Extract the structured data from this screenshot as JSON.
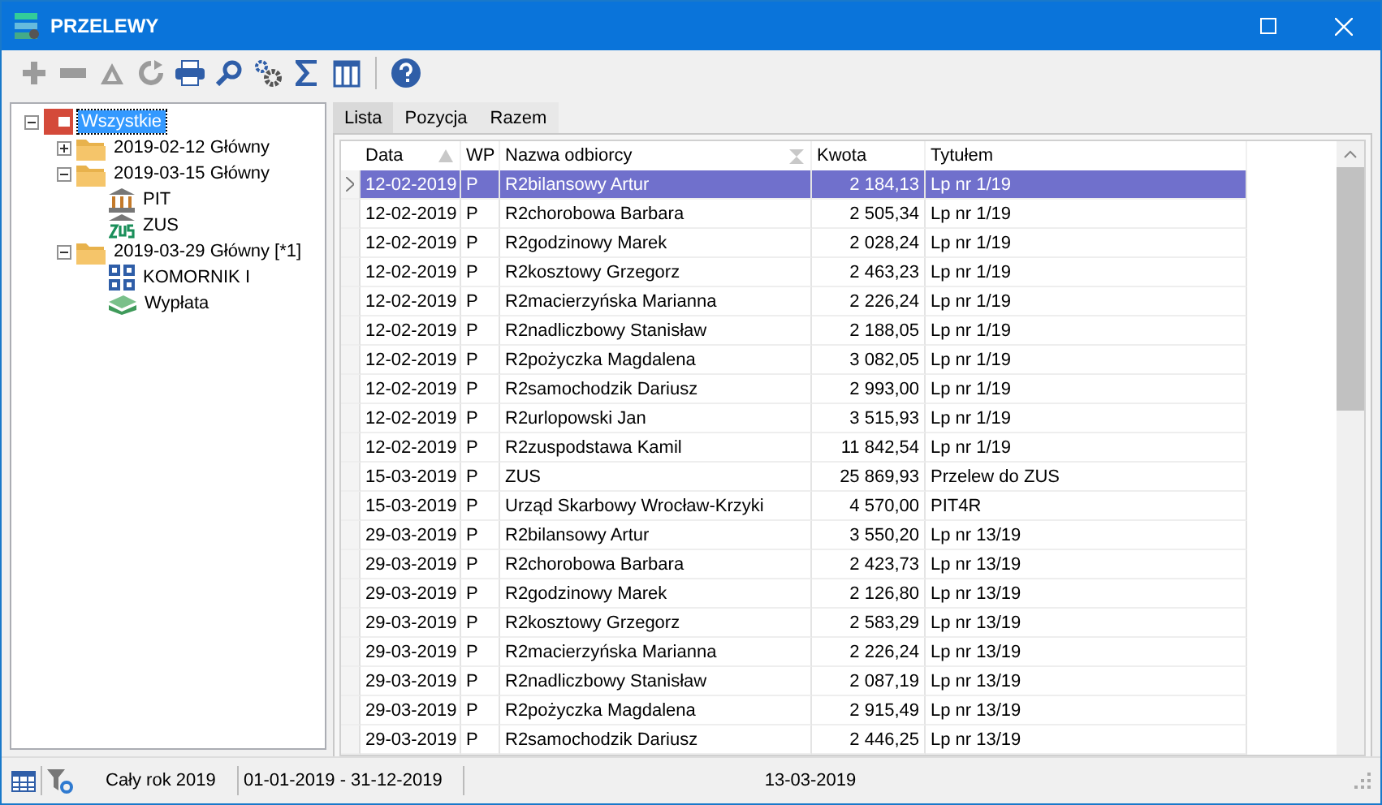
{
  "window": {
    "title": "PRZELEWY"
  },
  "toolbar": [
    {
      "kind": "add",
      "disabled": true
    },
    {
      "kind": "remove",
      "disabled": true
    },
    {
      "kind": "triangle",
      "disabled": true
    },
    {
      "kind": "refresh",
      "disabled": true
    },
    {
      "kind": "print",
      "disabled": false
    },
    {
      "kind": "search",
      "disabled": false
    },
    {
      "kind": "settings",
      "disabled": false
    },
    {
      "kind": "sum",
      "disabled": false
    },
    {
      "kind": "columns",
      "disabled": false
    },
    {
      "kind": "separator"
    },
    {
      "kind": "help",
      "disabled": false
    }
  ],
  "tree": [
    {
      "label": "Wszystkie",
      "kind": "root",
      "selected": true,
      "expanded": true,
      "children": [
        {
          "label": "2019-02-12 Główny",
          "kind": "folder",
          "selected": false,
          "expanded": false
        },
        {
          "label": "2019-03-15 Główny",
          "kind": "folder",
          "selected": false,
          "expanded": true,
          "children": [
            {
              "label": "PIT",
              "kind": "bank",
              "selected": false
            },
            {
              "label": "ZUS",
              "kind": "zus",
              "selected": false
            }
          ]
        },
        {
          "label": "2019-03-29 Główny [*1]",
          "kind": "folder",
          "selected": false,
          "expanded": true,
          "children": [
            {
              "label": "KOMORNIK I",
              "kind": "grid",
              "selected": false
            },
            {
              "label": "Wypłata",
              "kind": "money",
              "selected": false
            }
          ]
        }
      ]
    }
  ],
  "tabs": [
    {
      "label": "Lista",
      "selected": true
    },
    {
      "label": "Pozycja",
      "selected": false
    },
    {
      "label": "Razem",
      "selected": false
    }
  ],
  "table": {
    "columns": [
      {
        "label": "Data",
        "sorted": true,
        "summed": false
      },
      {
        "label": "WP",
        "sorted": false,
        "summed": false
      },
      {
        "label": "Nazwa odbiorcy",
        "sorted": false,
        "summed": true
      },
      {
        "label": "Kwota",
        "sorted": false,
        "summed": false
      },
      {
        "label": "Tytułem",
        "sorted": false,
        "summed": false
      }
    ],
    "rows": [
      {
        "cells": [
          "12-02-2019",
          "P",
          "R2bilansowy Artur",
          "2 184,13",
          "Lp nr 1/19"
        ],
        "selected": true
      },
      {
        "cells": [
          "12-02-2019",
          "P",
          "R2chorobowa Barbara",
          "2 505,34",
          "Lp nr 1/19"
        ],
        "selected": false
      },
      {
        "cells": [
          "12-02-2019",
          "P",
          "R2godzinowy Marek",
          "2 028,24",
          "Lp nr 1/19"
        ],
        "selected": false
      },
      {
        "cells": [
          "12-02-2019",
          "P",
          "R2kosztowy Grzegorz",
          "2 463,23",
          "Lp nr 1/19"
        ],
        "selected": false
      },
      {
        "cells": [
          "12-02-2019",
          "P",
          "R2macierzyńska Marianna",
          "2 226,24",
          "Lp nr 1/19"
        ],
        "selected": false
      },
      {
        "cells": [
          "12-02-2019",
          "P",
          "R2nadliczbowy Stanisław",
          "2 188,05",
          "Lp nr 1/19"
        ],
        "selected": false
      },
      {
        "cells": [
          "12-02-2019",
          "P",
          "R2pożyczka Magdalena",
          "3 082,05",
          "Lp nr 1/19"
        ],
        "selected": false
      },
      {
        "cells": [
          "12-02-2019",
          "P",
          "R2samochodzik Dariusz",
          "2 993,00",
          "Lp nr 1/19"
        ],
        "selected": false
      },
      {
        "cells": [
          "12-02-2019",
          "P",
          "R2urlopowski Jan",
          "3 515,93",
          "Lp nr 1/19"
        ],
        "selected": false
      },
      {
        "cells": [
          "12-02-2019",
          "P",
          "R2zuspodstawa Kamil",
          "11 842,54",
          "Lp nr 1/19"
        ],
        "selected": false
      },
      {
        "cells": [
          "15-03-2019",
          "P",
          "ZUS",
          "25 869,93",
          "Przelew do ZUS"
        ],
        "selected": false
      },
      {
        "cells": [
          "15-03-2019",
          "P",
          "Urząd Skarbowy Wrocław-Krzyki",
          "4 570,00",
          "PIT4R"
        ],
        "selected": false
      },
      {
        "cells": [
          "29-03-2019",
          "P",
          "R2bilansowy Artur",
          "3 550,20",
          "Lp nr 13/19"
        ],
        "selected": false
      },
      {
        "cells": [
          "29-03-2019",
          "P",
          "R2chorobowa Barbara",
          "2 423,73",
          "Lp nr 13/19"
        ],
        "selected": false
      },
      {
        "cells": [
          "29-03-2019",
          "P",
          "R2godzinowy Marek",
          "2 126,80",
          "Lp nr 13/19"
        ],
        "selected": false
      },
      {
        "cells": [
          "29-03-2019",
          "P",
          "R2kosztowy Grzegorz",
          "2 583,29",
          "Lp nr 13/19"
        ],
        "selected": false
      },
      {
        "cells": [
          "29-03-2019",
          "P",
          "R2macierzyńska Marianna",
          "2 226,24",
          "Lp nr 13/19"
        ],
        "selected": false
      },
      {
        "cells": [
          "29-03-2019",
          "P",
          "R2nadliczbowy Stanisław",
          "2 087,19",
          "Lp nr 13/19"
        ],
        "selected": false
      },
      {
        "cells": [
          "29-03-2019",
          "P",
          "R2pożyczka Magdalena",
          "2 915,49",
          "Lp nr 13/19"
        ],
        "selected": false
      },
      {
        "cells": [
          "29-03-2019",
          "P",
          "R2samochodzik Dariusz",
          "2 446,25",
          "Lp nr 13/19"
        ],
        "selected": false
      }
    ]
  },
  "status_bar": {
    "period": "Cały rok 2019",
    "range": "01-01-2019 - 31-12-2019",
    "date": "13-03-2019"
  }
}
